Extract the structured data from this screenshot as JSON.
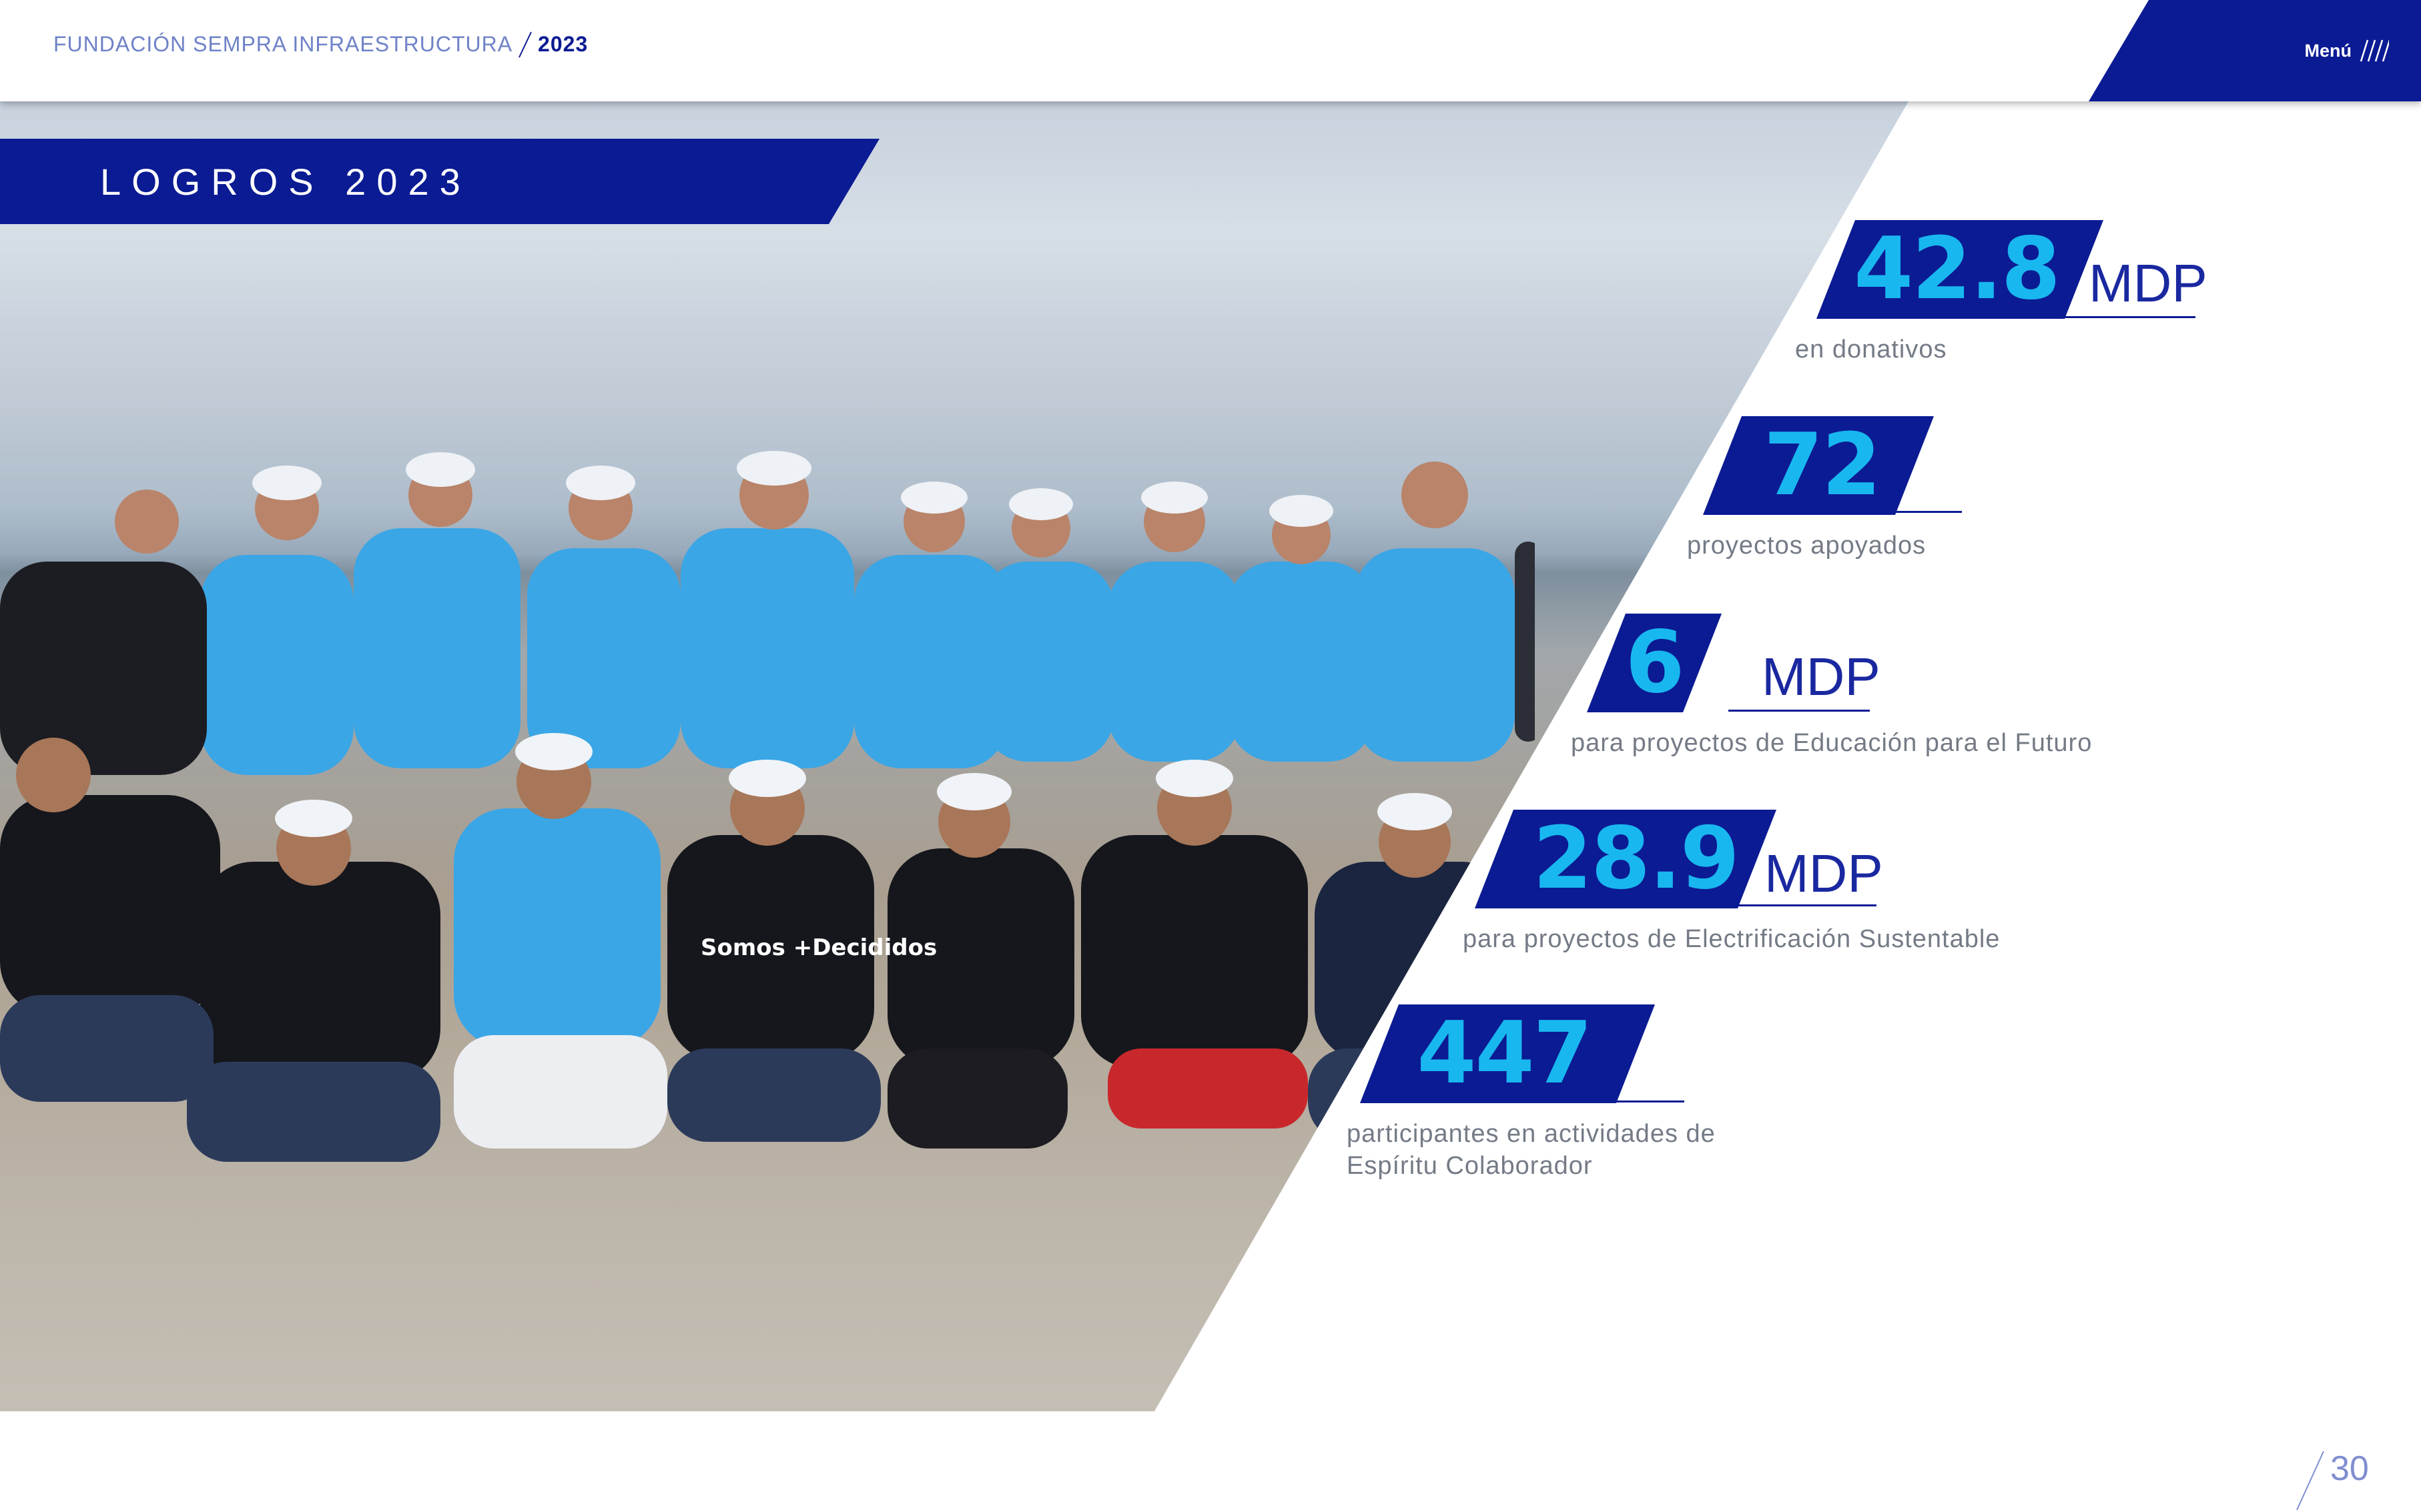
{
  "header": {
    "org_name": "FUNDACIÓN SEMPRA INFRAESTRUCTURA",
    "year": "2023",
    "menu_label": "Menú"
  },
  "title": "LOGROS 2023",
  "photo": {
    "shirt_text": "Somos +Decididos"
  },
  "stats": [
    {
      "value": "42.8",
      "unit": "MDP",
      "label": "en donativos"
    },
    {
      "value": "72",
      "unit": "",
      "label": "proyectos apoyados"
    },
    {
      "value": "6",
      "unit": "MDP",
      "label": "para proyectos de Educación para el Futuro"
    },
    {
      "value": "28.9",
      "unit": "MDP",
      "label": "para proyectos de Electrificación Sustentable"
    },
    {
      "value": "447",
      "unit": "",
      "label_line1": "participantes en actividades de",
      "label_line2": "Espíritu Colaborador"
    }
  ],
  "page_number": "30",
  "colors": {
    "brand_navy": "#0b1b93",
    "accent_cyan": "#19b7f0",
    "shirt_blue": "#3aa6e6",
    "label_gray": "#747b86"
  }
}
